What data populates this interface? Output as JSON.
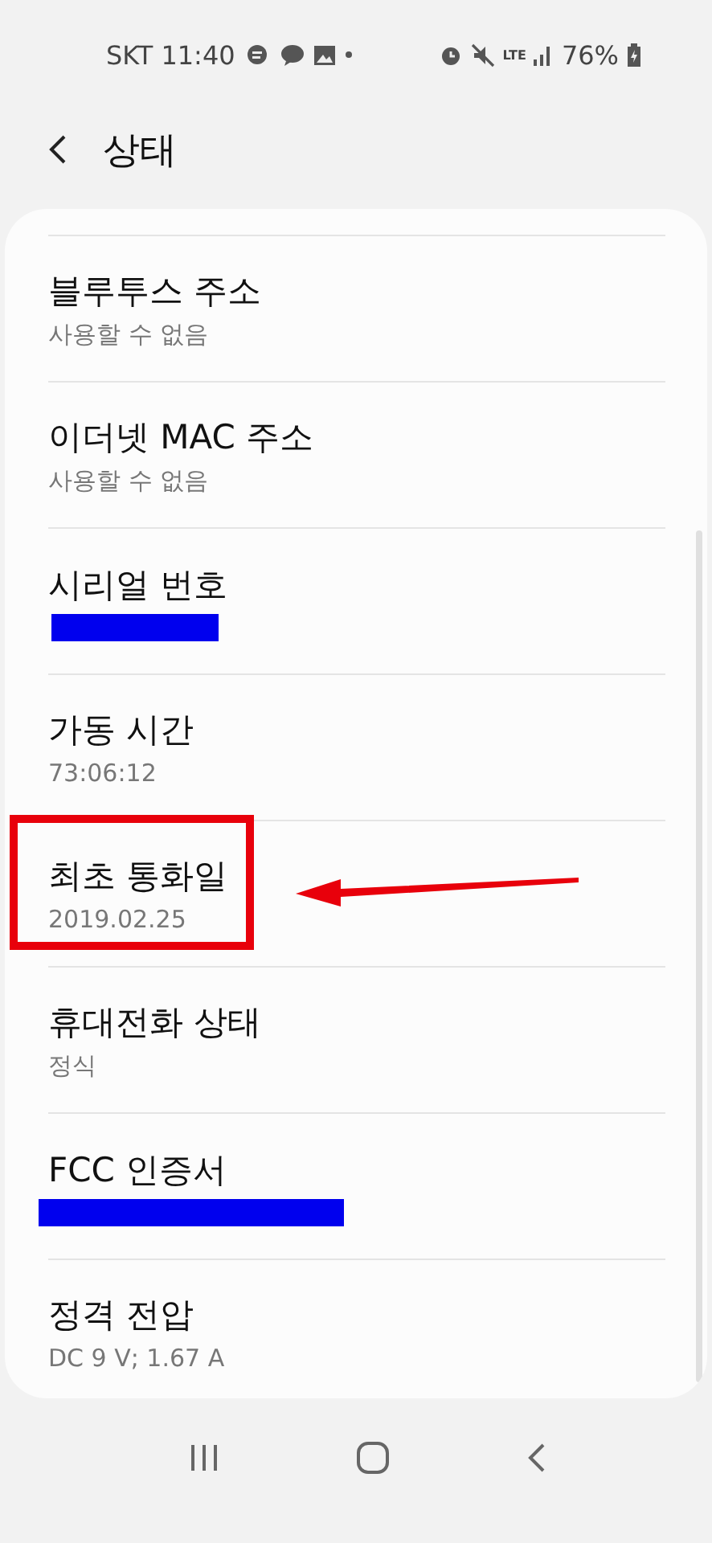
{
  "status_bar": {
    "carrier": "SKT",
    "time": "11:40",
    "network": "LTE",
    "battery": "76%"
  },
  "header": {
    "title": "상태"
  },
  "items": [
    {
      "title": "블루투스 주소",
      "kind": "value",
      "value": "사용할 수 없음",
      "highlighted": false
    },
    {
      "title": "이더넷 MAC 주소",
      "kind": "value",
      "value": "사용할 수 없음",
      "highlighted": false
    },
    {
      "title": "시리얼 번호",
      "kind": "redacted_short",
      "highlighted": false
    },
    {
      "title": "가동 시간",
      "kind": "value",
      "value": "73:06:12",
      "highlighted": false
    },
    {
      "title": "최초 통화일",
      "kind": "value",
      "value": "2019.02.25",
      "highlighted": true
    },
    {
      "title": "휴대전화 상태",
      "kind": "value",
      "value": "정식",
      "highlighted": false
    },
    {
      "title": "FCC 인증서",
      "kind": "redacted_long",
      "highlighted": false
    },
    {
      "title": "정격 전압",
      "kind": "value",
      "value": "DC 9 V; 1.67 A",
      "highlighted": false
    }
  ]
}
